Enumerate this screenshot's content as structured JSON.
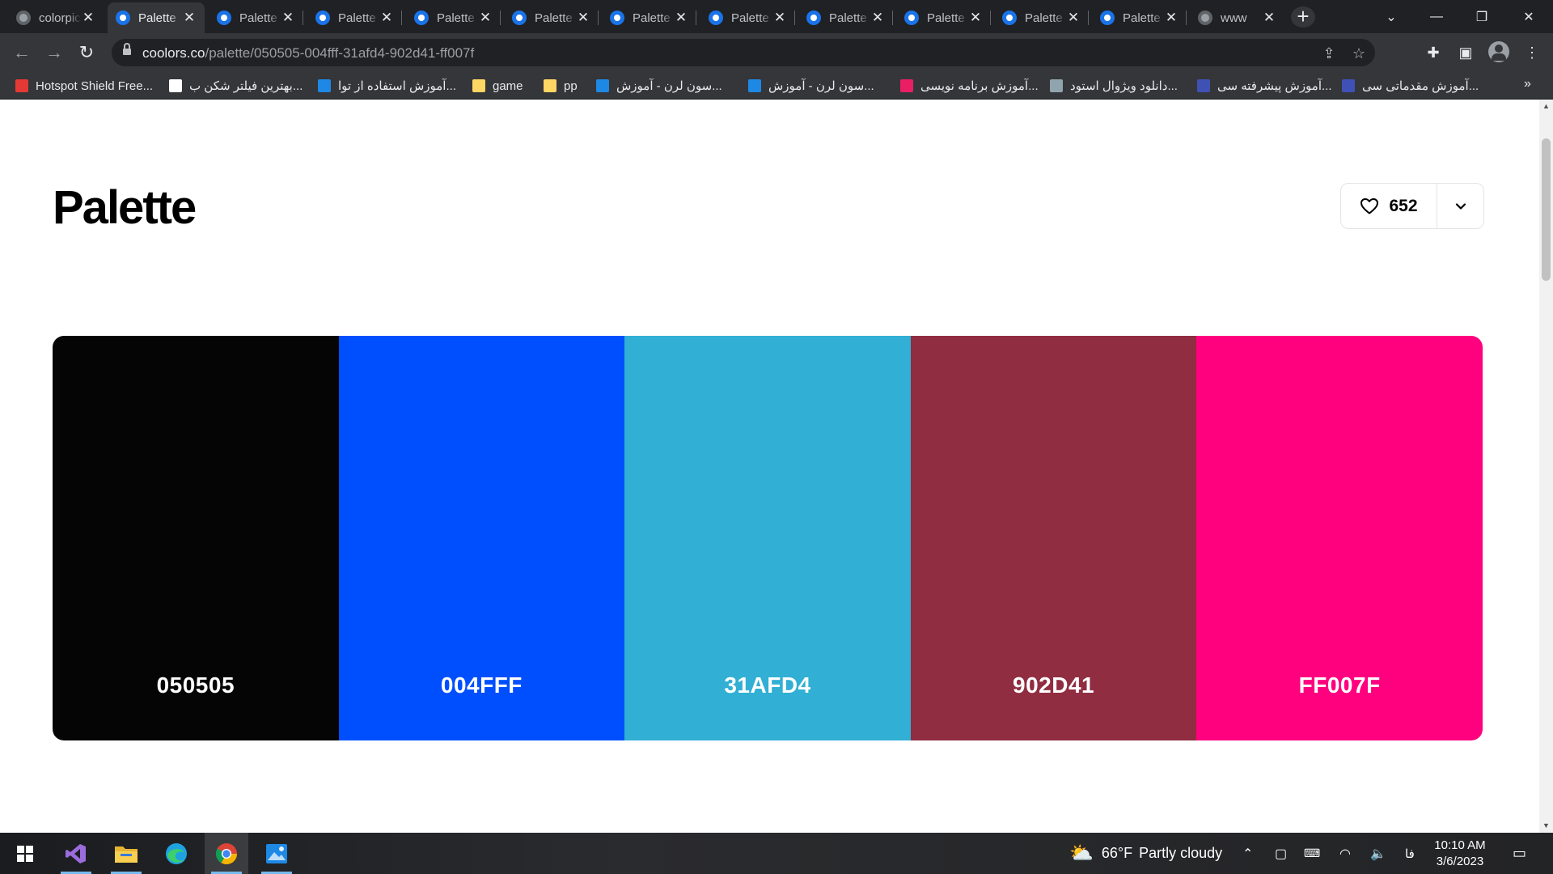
{
  "browser": {
    "tabs": [
      {
        "title": "colorpicker",
        "icon": "globe",
        "active": false
      },
      {
        "title": "Palette",
        "icon": "coolors",
        "active": true
      },
      {
        "title": "Palette",
        "icon": "coolors",
        "active": false
      },
      {
        "title": "Palette",
        "icon": "coolors",
        "active": false
      },
      {
        "title": "Palette",
        "icon": "coolors",
        "active": false
      },
      {
        "title": "Palette",
        "icon": "coolors",
        "active": false
      },
      {
        "title": "Palette",
        "icon": "coolors",
        "active": false
      },
      {
        "title": "Palette",
        "icon": "coolors",
        "active": false
      },
      {
        "title": "Palette",
        "icon": "coolors",
        "active": false
      },
      {
        "title": "Palette",
        "icon": "coolors",
        "active": false
      },
      {
        "title": "Palette",
        "icon": "coolors",
        "active": false
      },
      {
        "title": "Palette",
        "icon": "coolors",
        "active": false
      },
      {
        "title": "www",
        "icon": "globe",
        "active": false
      }
    ],
    "url_host": "coolors.co",
    "url_path": "/palette/050505-004fff-31afd4-902d41-ff007f",
    "bookmarks": [
      {
        "label": "Hotspot Shield Free...",
        "color": "#e53935"
      },
      {
        "label": "بهترین فیلتر شکن ب...",
        "color": "#ffffff"
      },
      {
        "label": "آموزش استفاده از توا...",
        "color": "#1e88e5"
      },
      {
        "label": "game",
        "color": "#fdd663"
      },
      {
        "label": "pp",
        "color": "#fdd663"
      },
      {
        "label": "سون لرن - آموزش...",
        "color": "#1e88e5"
      },
      {
        "label": "سون لرن - آموزش...",
        "color": "#1e88e5"
      },
      {
        "label": "آموزش برنامه نویسی...",
        "color": "#e91e63"
      },
      {
        "label": "دانلود ویژوال استود...",
        "color": "#90a4ae"
      },
      {
        "label": "آموزش پیشرفته سی...",
        "color": "#3f51b5"
      },
      {
        "label": "آموزش مقدماتی سی...",
        "color": "#3f51b5"
      }
    ]
  },
  "page": {
    "title": "Palette",
    "likes": "652",
    "colors": [
      {
        "hex": "050505",
        "color": "#050505"
      },
      {
        "hex": "004FFF",
        "color": "#004FFF"
      },
      {
        "hex": "31AFD4",
        "color": "#31AFD4"
      },
      {
        "hex": "902D41",
        "color": "#902D41"
      },
      {
        "hex": "FF007F",
        "color": "#FF007F"
      }
    ]
  },
  "taskbar": {
    "apps": [
      {
        "name": "visual-studio",
        "icon": "visual-studio-icon"
      },
      {
        "name": "file-explorer",
        "icon": "folder-icon"
      },
      {
        "name": "edge",
        "icon": "edge-icon"
      },
      {
        "name": "chrome",
        "icon": "chrome-icon"
      },
      {
        "name": "photos",
        "icon": "photos-icon"
      }
    ],
    "weather_temp": "66°F",
    "weather_text": "Partly cloudy",
    "language": "فا",
    "time": "10:10 AM",
    "date": "3/6/2023"
  }
}
